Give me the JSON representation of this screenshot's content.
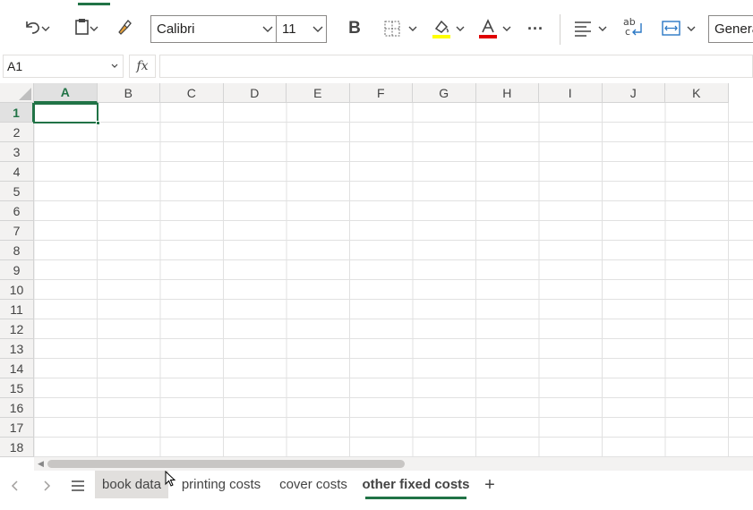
{
  "ribbon": {
    "font_name": "Calibri",
    "font_size": "11",
    "bold_label": "B",
    "more_label": "···",
    "number_format": "Genera",
    "highlight_color": "#ffff00",
    "font_color": "#e00000",
    "icons": [
      "undo-icon",
      "paste-icon",
      "format-painter-icon",
      "borders-icon",
      "fill-color-icon",
      "font-color-icon",
      "more-icon",
      "align-icon",
      "wrap-text-icon",
      "merge-icon"
    ]
  },
  "formula_bar": {
    "name_box": "A1",
    "fx_label": "fx",
    "formula": ""
  },
  "grid": {
    "columns": [
      "A",
      "B",
      "C",
      "D",
      "E",
      "F",
      "G",
      "H",
      "I",
      "J",
      "K"
    ],
    "rows": [
      "1",
      "2",
      "3",
      "4",
      "5",
      "6",
      "7",
      "8",
      "9",
      "10",
      "11",
      "12",
      "13",
      "14",
      "15",
      "16",
      "17",
      "18"
    ],
    "selected_cell": "A1"
  },
  "sheets": {
    "tabs": [
      {
        "label": "book data"
      },
      {
        "label": "printing costs"
      },
      {
        "label": "cover costs"
      },
      {
        "label": "other fixed costs"
      }
    ],
    "active": "other fixed costs",
    "add_label": "+"
  },
  "colors": {
    "accent": "#217346"
  }
}
